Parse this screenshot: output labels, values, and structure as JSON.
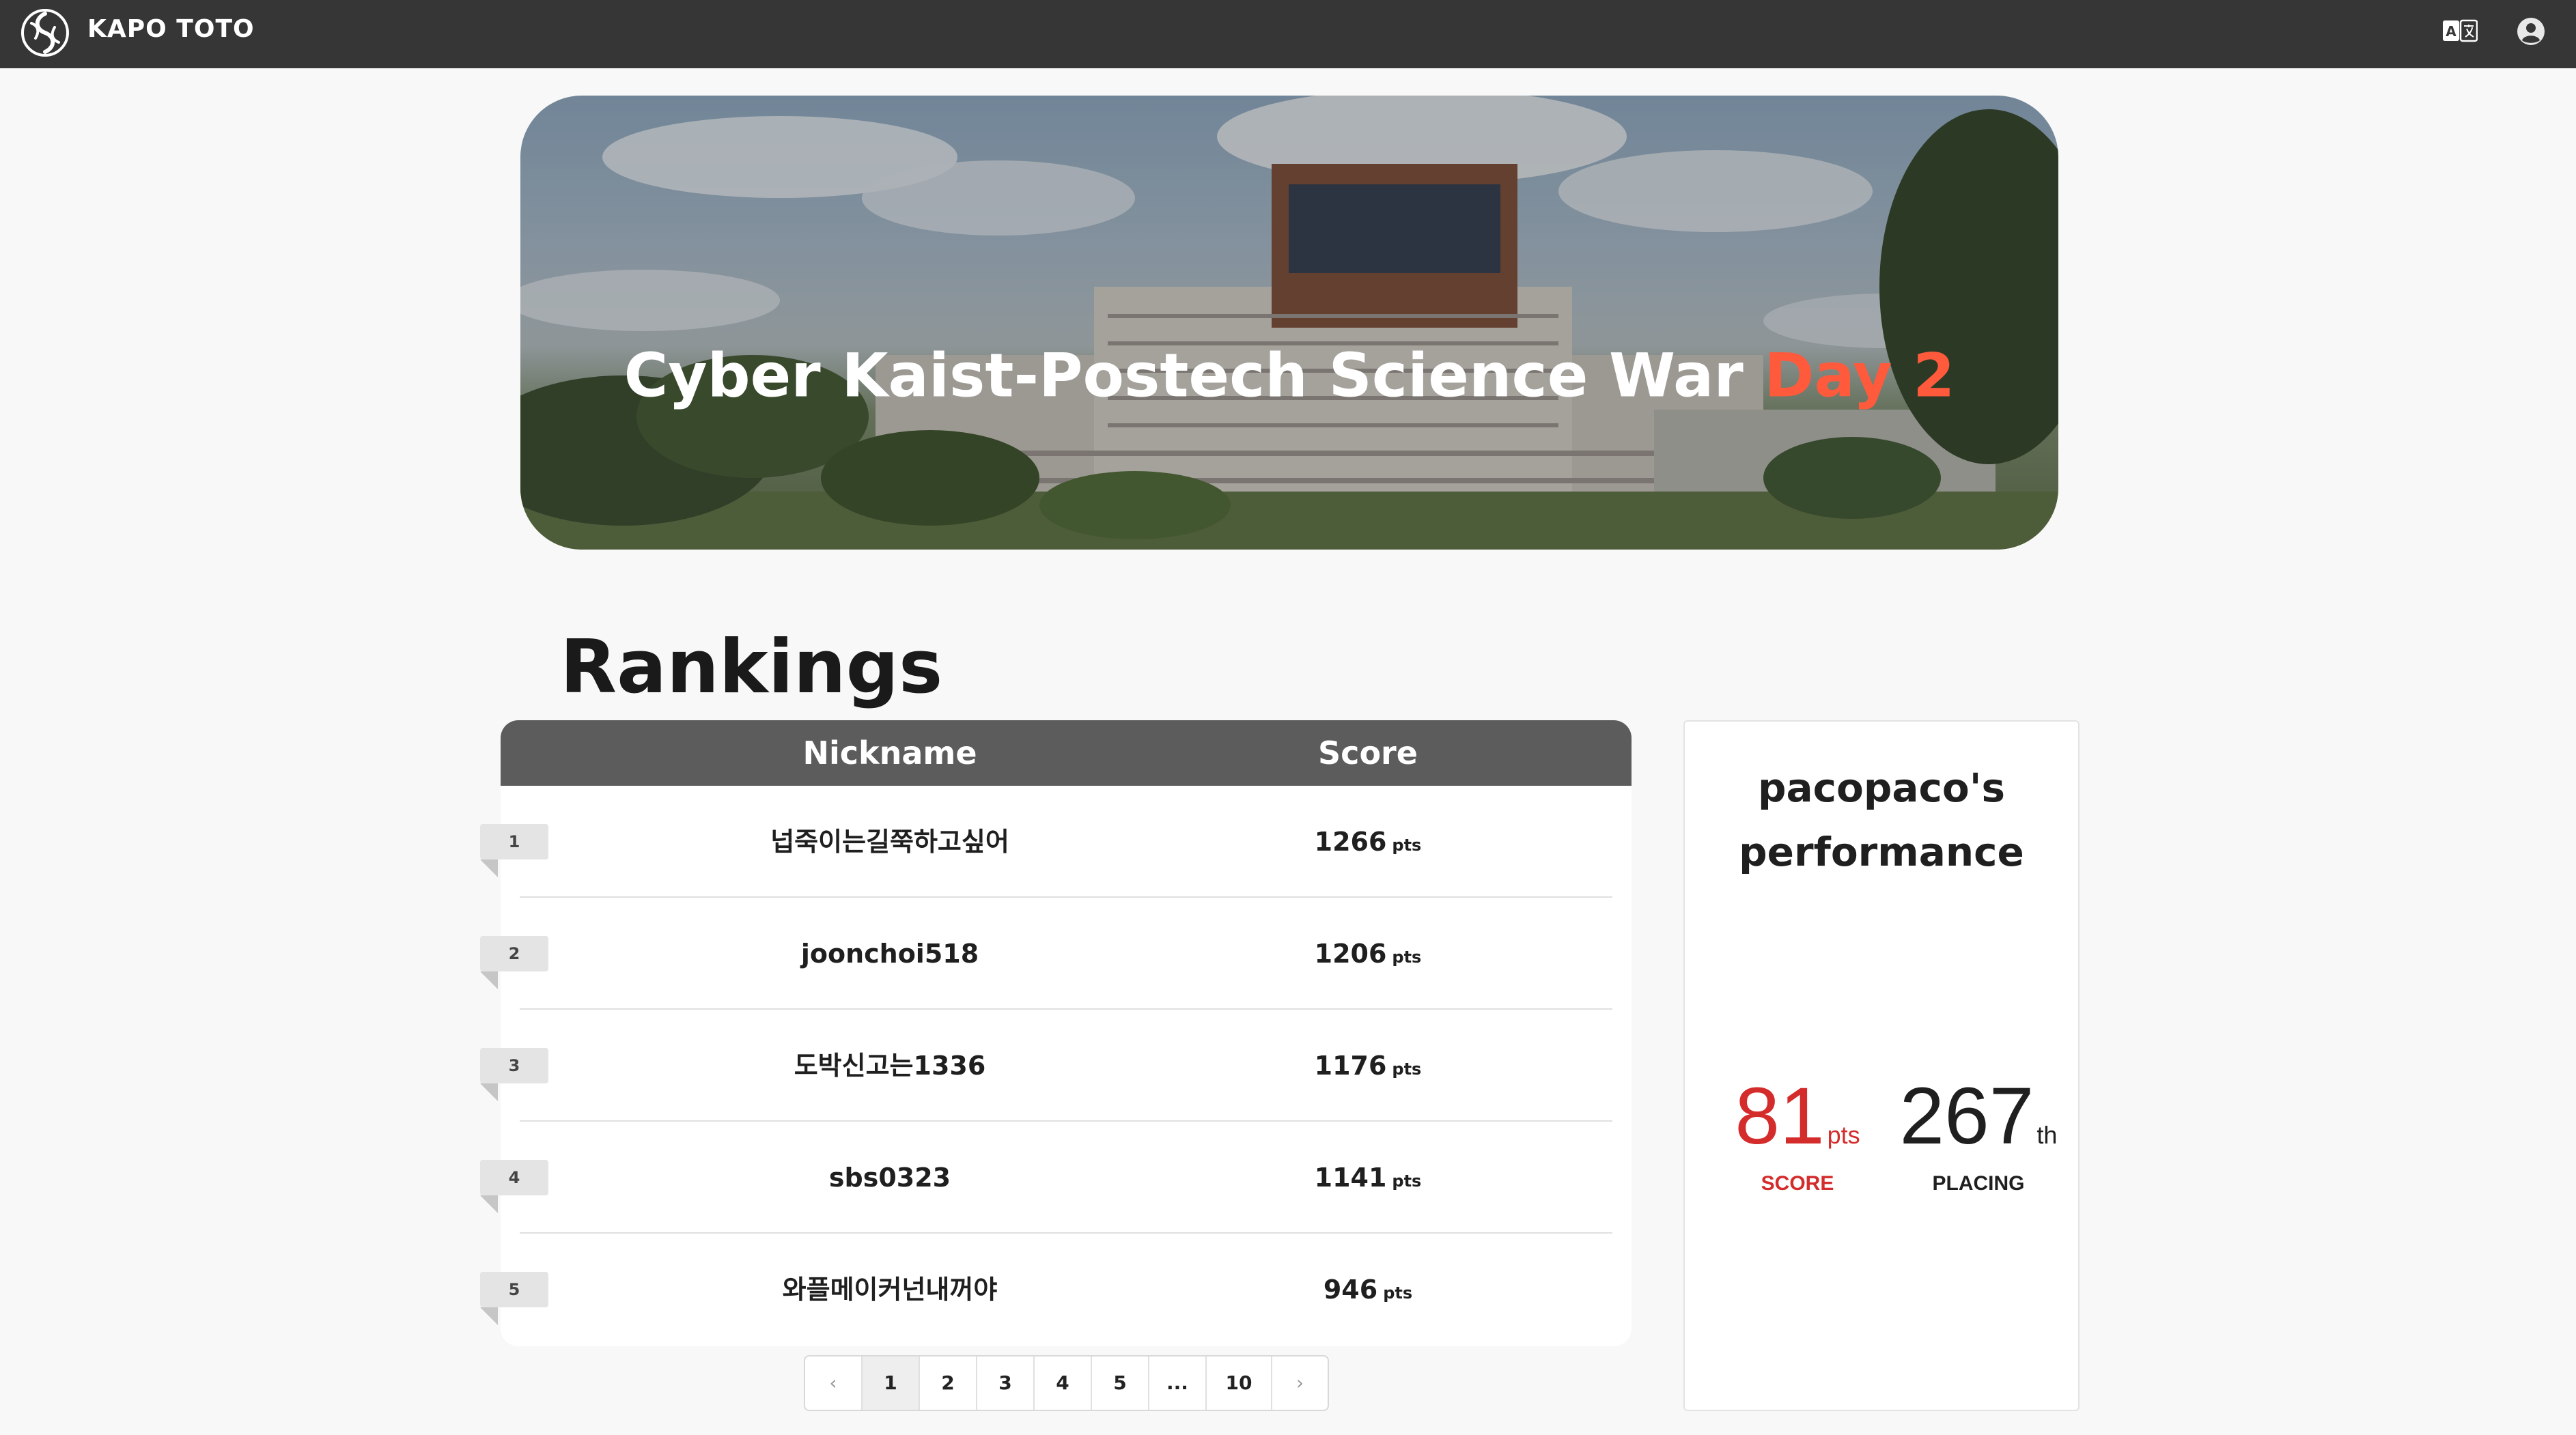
{
  "app": {
    "name": "KAPO TOTO"
  },
  "header": {
    "translate_icon": "translate-icon",
    "account_icon": "account-circle-icon"
  },
  "hero": {
    "title_main": "Cyber Kaist-Postech Science War",
    "title_accent": "Day 2",
    "accent_color": "#ff5a3c"
  },
  "rankings": {
    "heading": "Rankings",
    "columns": {
      "nickname": "Nickname",
      "score": "Score"
    },
    "unit": "pts",
    "rows": [
      {
        "rank": "1",
        "nickname": "넙죽이는길쭉하고싶어",
        "score": "1266"
      },
      {
        "rank": "2",
        "nickname": "joonchoi518",
        "score": "1206"
      },
      {
        "rank": "3",
        "nickname": "도박신고는1336",
        "score": "1176"
      },
      {
        "rank": "4",
        "nickname": "sbs0323",
        "score": "1141"
      },
      {
        "rank": "5",
        "nickname": "와플메이커넌내꺼야",
        "score": "946"
      }
    ]
  },
  "pagination": {
    "prev": "‹",
    "pages": [
      "1",
      "2",
      "3",
      "4",
      "5",
      "...",
      "10"
    ],
    "active_page": "1",
    "next": "›"
  },
  "performance": {
    "title_line1": "pacopaco's",
    "title_line2": "performance",
    "score_value": "81",
    "score_unit": "pts",
    "score_label": "SCORE",
    "placing_value": "267",
    "placing_suffix": "th",
    "placing_label": "PLACING",
    "score_color": "#d42b2b"
  }
}
